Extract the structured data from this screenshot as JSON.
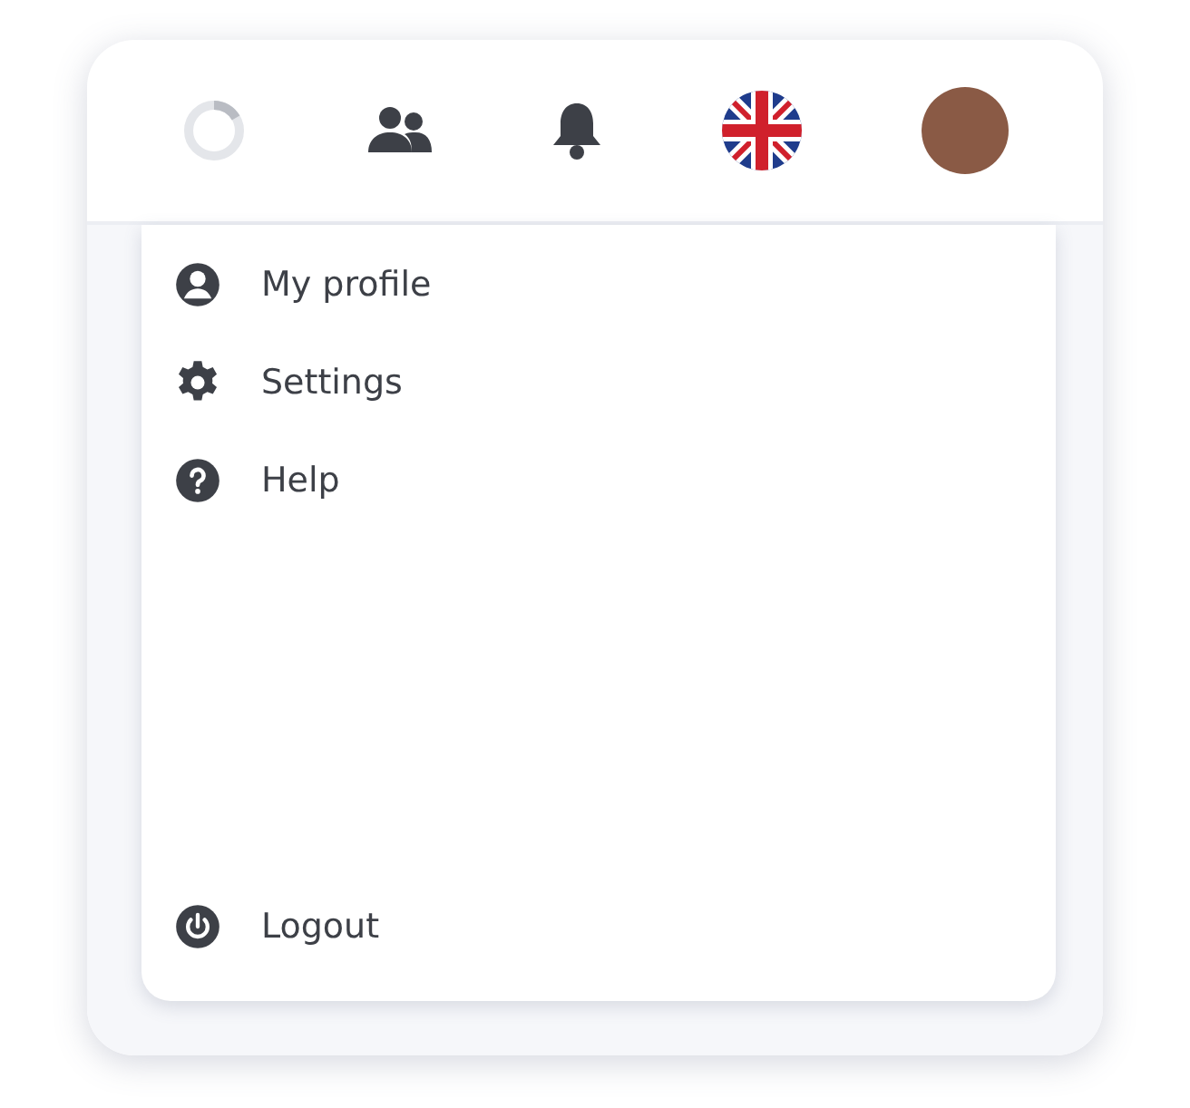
{
  "menu": {
    "items": [
      {
        "label": "My profile",
        "kind": "profile"
      },
      {
        "label": "Settings",
        "kind": "settings"
      },
      {
        "label": "Help",
        "kind": "help"
      },
      {
        "label": "Logout",
        "kind": "logout"
      }
    ]
  }
}
